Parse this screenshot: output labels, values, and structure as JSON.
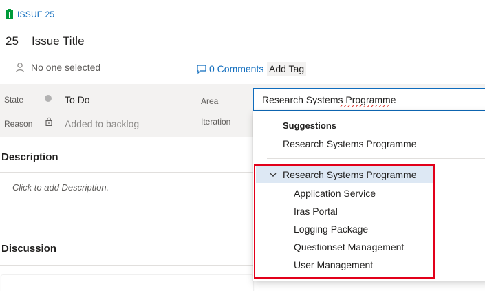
{
  "header": {
    "issue_label": "ISSUE 25",
    "issue_id": "25",
    "title": "Issue Title",
    "assignee": "No one selected",
    "comments": "0 Comments",
    "add_tag": "Add Tag"
  },
  "fields": {
    "state_label": "State",
    "state_value": "To Do",
    "reason_label": "Reason",
    "reason_value": "Added to backlog",
    "area_label": "Area",
    "iteration_label": "Iteration",
    "area_input_value": "Research Systems Programme"
  },
  "description": {
    "heading": "Description",
    "placeholder": "Click to add Description."
  },
  "discussion": {
    "heading": "Discussion"
  },
  "dropdown": {
    "suggestions_heading": "Suggestions",
    "suggestion_item": "Research Systems Programme",
    "tree_root": "Research Systems Programme",
    "tree_children": [
      "Application Service",
      "Iras Portal",
      "Logging Package",
      "Questionset Management",
      "User Management"
    ]
  },
  "colors": {
    "accent": "#0f6cbd",
    "issue_icon": "#009b3a",
    "selected_row": "#dde8f4",
    "highlight_box": "#e2001a",
    "band": "#f3f2f1"
  },
  "icons": [
    "issue-icon",
    "person-icon",
    "comment-icon",
    "lock-icon",
    "chevron-down-icon"
  ]
}
